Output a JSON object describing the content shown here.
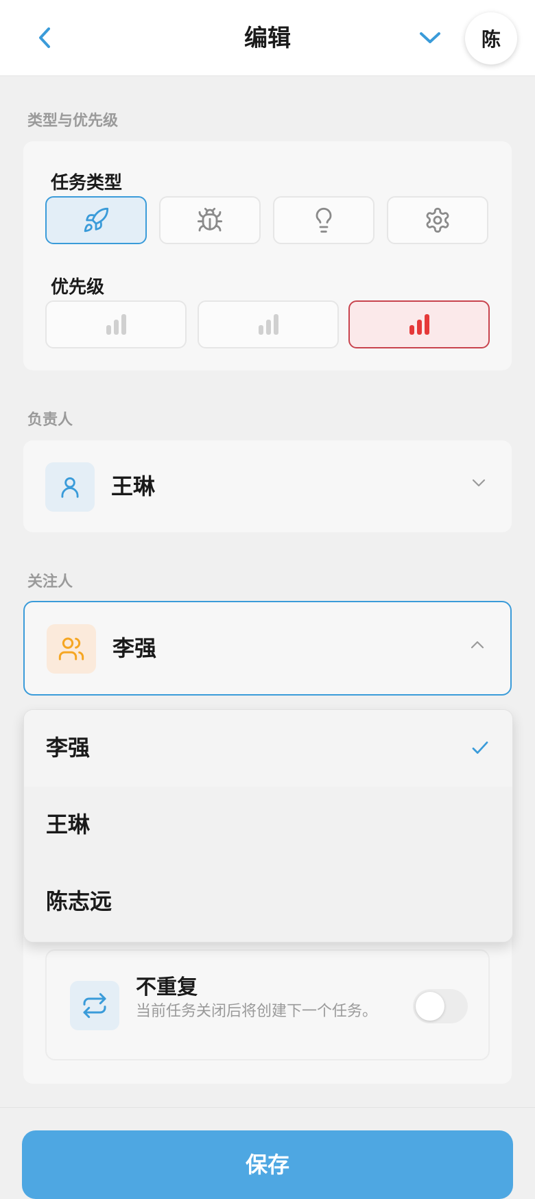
{
  "header": {
    "title": "编辑",
    "avatar_text": "陈"
  },
  "sections": {
    "type_priority": "类型与优先级",
    "assignee": "负责人",
    "watcher": "关注人"
  },
  "task_type": {
    "label": "任务类型",
    "options": [
      {
        "icon": "rocket-icon",
        "selected": true
      },
      {
        "icon": "bug-icon",
        "selected": false
      },
      {
        "icon": "lightbulb-icon",
        "selected": false
      },
      {
        "icon": "gear-icon",
        "selected": false
      }
    ]
  },
  "priority": {
    "label": "优先级",
    "options": [
      {
        "level": "low",
        "selected": false
      },
      {
        "level": "medium",
        "selected": false
      },
      {
        "level": "high",
        "selected": true
      }
    ]
  },
  "assignee": {
    "value": "王琳",
    "icon": "user-icon"
  },
  "watcher": {
    "value": "李强",
    "icon": "users-icon",
    "dropdown_open": true,
    "options": [
      "李强",
      "王琳",
      "陈志远"
    ],
    "selected": "李强"
  },
  "repeat": {
    "title": "不重复",
    "description": "当前任务关闭后将创建下一个任务。",
    "enabled": false
  },
  "footer": {
    "save_label": "保存"
  },
  "colors": {
    "accent": "#3a9bd9",
    "priority_high": "#e53939",
    "watcher_icon": "#f5a623",
    "save_button": "#4ea7e2"
  }
}
